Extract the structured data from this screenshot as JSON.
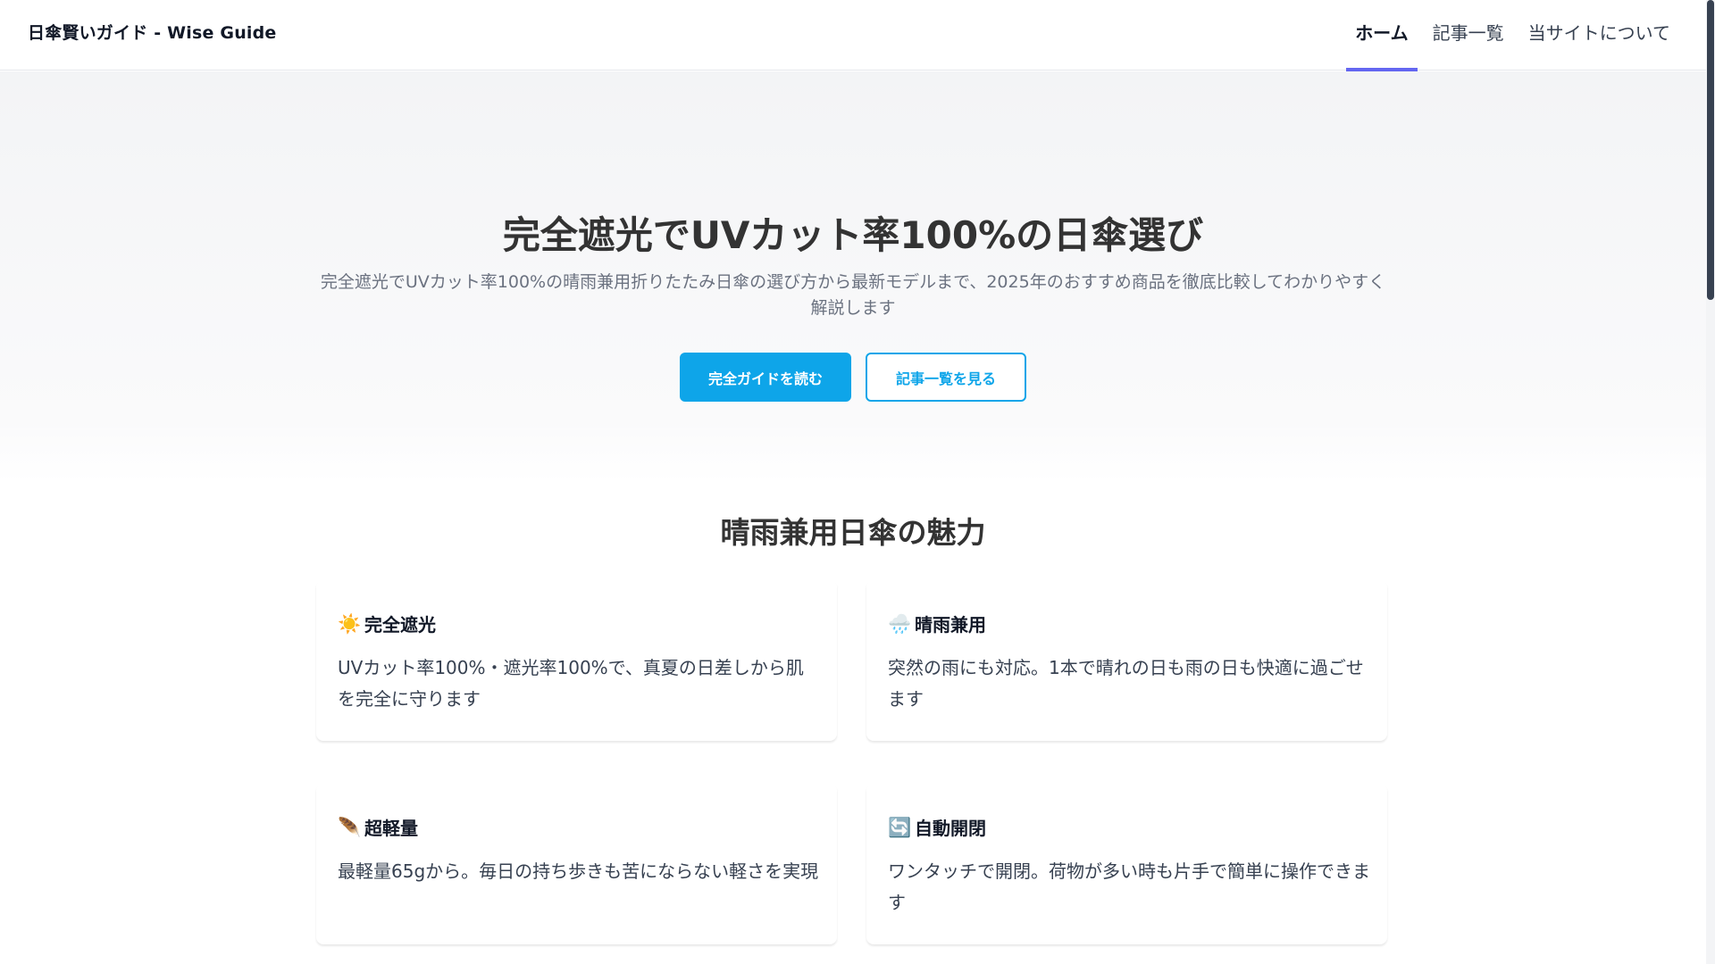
{
  "header": {
    "logo": "日傘賢いガイド - Wise Guide",
    "nav": [
      {
        "label": "ホーム",
        "active": true
      },
      {
        "label": "記事一覧",
        "active": false
      },
      {
        "label": "当サイトについて",
        "active": false
      }
    ],
    "active_color": "#6366f1"
  },
  "hero": {
    "title": "完全遮光でUVカット率100%の日傘選び",
    "subtitle": "完全遮光でUVカット率100%の晴雨兼用折りたたみ日傘の選び方から最新モデルまで、2025年のおすすめ商品を徹底比較してわかりやすく解説します",
    "primary_button": "完全ガイドを読む",
    "secondary_button": "記事一覧を見る",
    "accent_color": "#0ea5e9"
  },
  "features": {
    "title": "晴雨兼用日傘の魅力",
    "items": [
      {
        "icon_name": "sun-icon",
        "icon": "☀️",
        "title": "完全遮光",
        "text": "UVカット率100%・遮光率100%で、真夏の日差しから肌を完全に守ります"
      },
      {
        "icon_name": "rain-cloud-icon",
        "icon": "🌧️",
        "title": "晴雨兼用",
        "text": "突然の雨にも対応。1本で晴れの日も雨の日も快適に過ごせます"
      },
      {
        "icon_name": "feather-icon",
        "icon": "🪶",
        "title": "超軽量",
        "text": "最軽量65gから。毎日の持ち歩きも苦にならない軽さを実現"
      },
      {
        "icon_name": "auto-open-icon",
        "icon": "🔄",
        "title": "自動開閉",
        "text": "ワンタッチで開閉。荷物が多い時も片手で簡単に操作できます"
      }
    ]
  }
}
